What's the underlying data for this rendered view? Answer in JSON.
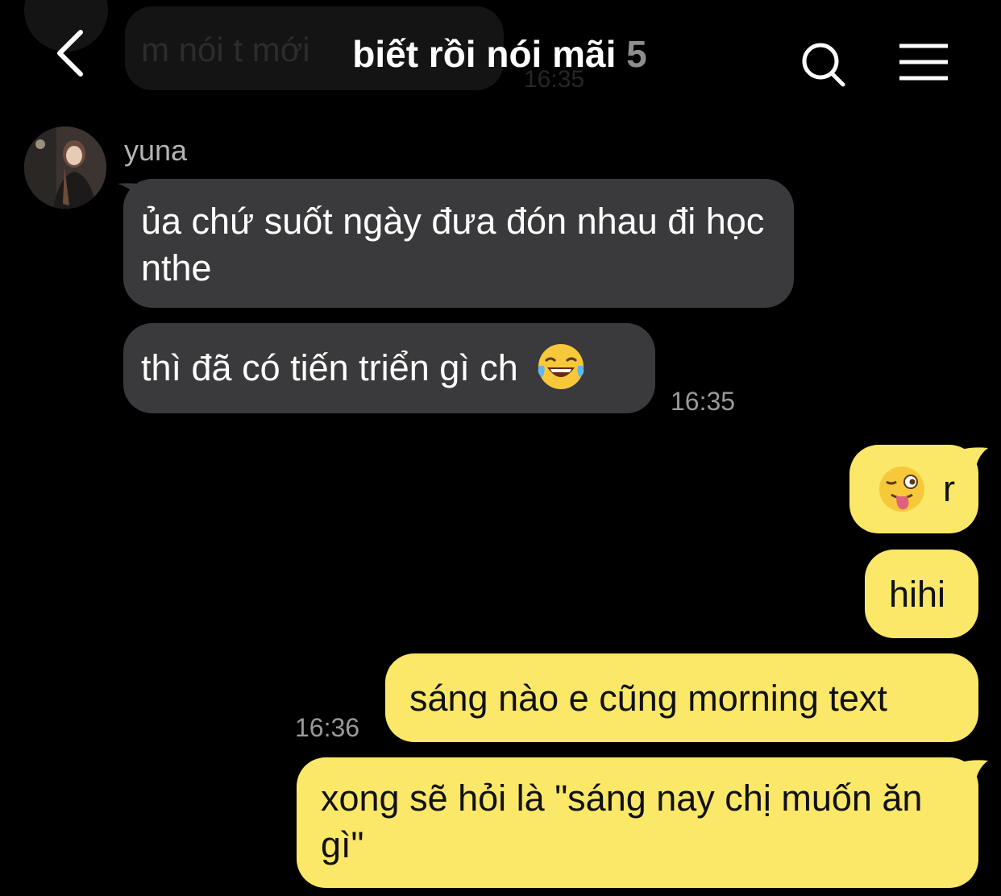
{
  "previous_message": {
    "text": "m nói t mới",
    "time": "16:35"
  },
  "header": {
    "back_icon": "chevron-left-icon",
    "title": "biết rồi nói mãi",
    "member_count": "5",
    "search_icon": "search-icon",
    "menu_icon": "hamburger-menu-icon"
  },
  "incoming": {
    "sender": "yuna",
    "messages": [
      {
        "text": "ủa chứ suốt ngày đưa đón nhau đi học nthe"
      },
      {
        "text": "thì đã có tiến triển gì ch",
        "emoji": "laughing-tears-emoji"
      }
    ],
    "time": "16:35"
  },
  "outgoing": {
    "messages": [
      {
        "emoji": "winking-tongue-emoji",
        "text": "r"
      },
      {
        "text": "hihi"
      },
      {
        "text": "sáng nào e cũng morning text"
      },
      {
        "text": "xong sẽ hỏi là \"sáng nay chị muốn ăn gì\""
      }
    ],
    "time": "16:36"
  },
  "colors": {
    "background": "#000000",
    "incoming_bubble": "#3a3a3c",
    "outgoing_bubble": "#fbe768",
    "timestamp": "#9a9a9a"
  }
}
